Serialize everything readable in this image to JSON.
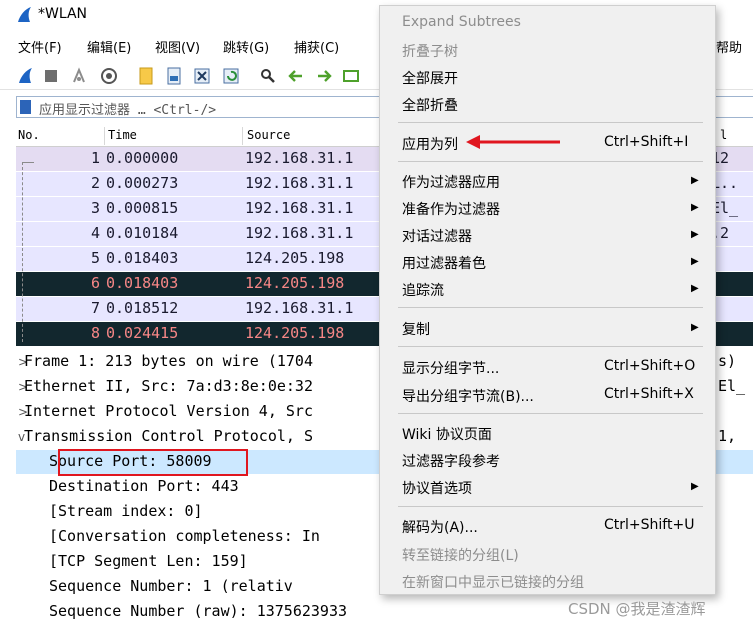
{
  "window": {
    "title": "*WLAN"
  },
  "menubar": {
    "items": [
      "文件(F)",
      "编辑(E)",
      "视图(V)",
      "跳转(G)",
      "捕获(C)"
    ],
    "right_partial": "帮助"
  },
  "filter": {
    "placeholder": "应用显示过滤器 … <Ctrl-/>"
  },
  "packet_list": {
    "columns": [
      "No.",
      "Time",
      "Source"
    ],
    "right_col_partial": "l",
    "rows": [
      {
        "no": "1",
        "time": "0.000000",
        "src": "192.168.31.1",
        "info": "12",
        "bg": "#e4dcf2",
        "fg": "#1a1a2e"
      },
      {
        "no": "2",
        "time": "0.000273",
        "src": "192.168.31.1",
        "info": "L..",
        "bg": "#e7e6ff",
        "fg": "#1a1a2e"
      },
      {
        "no": "3",
        "time": "0.000815",
        "src": "192.168.31.1",
        "info": "El_",
        "bg": "#e7e6ff",
        "fg": "#1a1a2e"
      },
      {
        "no": "4",
        "time": "0.010184",
        "src": "192.168.31.1",
        "info": ".2",
        "bg": "#e7e6ff",
        "fg": "#1a1a2e"
      },
      {
        "no": "5",
        "time": "0.018403",
        "src": "124.205.198",
        "info": "",
        "bg": "#e7e6ff",
        "fg": "#1a1a2e"
      },
      {
        "no": "6",
        "time": "0.018403",
        "src": "124.205.198",
        "info": "",
        "bg": "#12272e",
        "fg": "#f78787"
      },
      {
        "no": "7",
        "time": "0.018512",
        "src": "192.168.31.1",
        "info": "",
        "bg": "#e7e6ff",
        "fg": "#1a1a2e"
      },
      {
        "no": "8",
        "time": "0.024415",
        "src": "124.205.198",
        "info": "",
        "bg": "#12272e",
        "fg": "#f78787"
      }
    ]
  },
  "details": {
    "lines": [
      {
        "expander": ">",
        "text": "Frame 1: 213 bytes on wire (1704",
        "tail": "s)"
      },
      {
        "expander": ">",
        "text": "Ethernet II, Src: 7a:d3:8e:0e:32",
        "tail": "El_"
      },
      {
        "expander": ">",
        "text": "Internet Protocol Version 4, Src",
        "tail": ""
      },
      {
        "expander": "v",
        "text": "Transmission Control Protocol, S",
        "tail": "1,"
      },
      {
        "expander": "",
        "text": "Source Port: 58009",
        "tail": ""
      },
      {
        "expander": "",
        "text": "Destination Port: 443",
        "tail": ""
      },
      {
        "expander": "",
        "text": "[Stream index: 0]",
        "tail": ""
      },
      {
        "expander": "",
        "text": "[Conversation completeness: In",
        "tail": ""
      },
      {
        "expander": "",
        "text": "[TCP Segment Len: 159]",
        "tail": ""
      },
      {
        "expander": "",
        "text": "Sequence Number: 1    (relativ",
        "tail": ""
      },
      {
        "expander": "",
        "text": "Sequence Number (raw): 1375623933",
        "tail": ""
      }
    ]
  },
  "context_menu": {
    "items": [
      {
        "label": "Expand Subtrees",
        "shortcut": "",
        "arrow": false,
        "disabled": true
      },
      {
        "label": "折叠子树",
        "shortcut": "",
        "arrow": false,
        "disabled": true
      },
      {
        "label": "全部展开",
        "shortcut": "",
        "arrow": false,
        "disabled": false
      },
      {
        "label": "全部折叠",
        "shortcut": "",
        "arrow": false,
        "disabled": false
      },
      {
        "label": "应用为列",
        "shortcut": "Ctrl+Shift+I",
        "arrow": false,
        "disabled": false
      },
      {
        "label": "作为过滤器应用",
        "shortcut": "",
        "arrow": true,
        "disabled": false
      },
      {
        "label": "准备作为过滤器",
        "shortcut": "",
        "arrow": true,
        "disabled": false
      },
      {
        "label": "对话过滤器",
        "shortcut": "",
        "arrow": true,
        "disabled": false
      },
      {
        "label": "用过滤器着色",
        "shortcut": "",
        "arrow": true,
        "disabled": false
      },
      {
        "label": "追踪流",
        "shortcut": "",
        "arrow": true,
        "disabled": false
      },
      {
        "label": "复制",
        "shortcut": "",
        "arrow": true,
        "disabled": false
      },
      {
        "label": "显示分组字节...",
        "shortcut": "Ctrl+Shift+O",
        "arrow": false,
        "disabled": false
      },
      {
        "label": "导出分组字节流(B)...",
        "shortcut": "Ctrl+Shift+X",
        "arrow": false,
        "disabled": false
      },
      {
        "label": "Wiki 协议页面",
        "shortcut": "",
        "arrow": false,
        "disabled": false
      },
      {
        "label": "过滤器字段参考",
        "shortcut": "",
        "arrow": false,
        "disabled": false
      },
      {
        "label": "协议首选项",
        "shortcut": "",
        "arrow": true,
        "disabled": false
      },
      {
        "label": "解码为(A)...",
        "shortcut": "Ctrl+Shift+U",
        "arrow": false,
        "disabled": false
      },
      {
        "label": "转至链接的分组(L)",
        "shortcut": "",
        "arrow": false,
        "disabled": true
      },
      {
        "label": "在新窗口中显示已链接的分组",
        "shortcut": "",
        "arrow": false,
        "disabled": true
      }
    ]
  },
  "colors": {
    "annotation_red": "#e0161f",
    "selected_row": "#cce8ff",
    "dark_row": "#12272e"
  },
  "watermark": "CSDN @我是渣渣辉"
}
